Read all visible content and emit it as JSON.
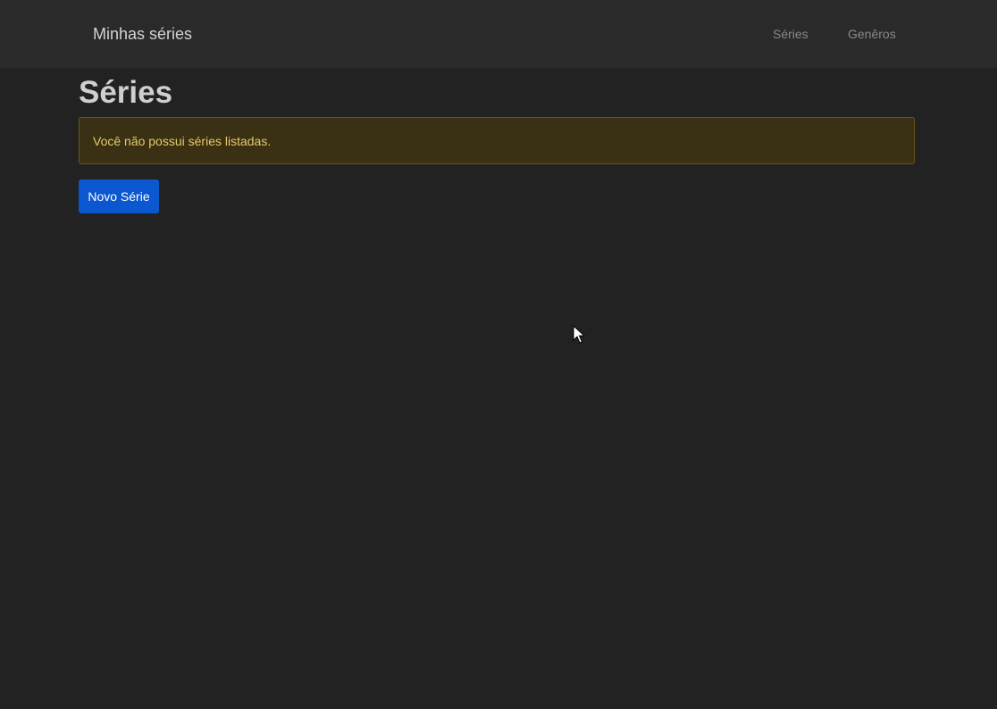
{
  "navbar": {
    "brand": "Minhas séries",
    "links": [
      {
        "label": "Séries"
      },
      {
        "label": "Genêros"
      }
    ]
  },
  "main": {
    "title": "Séries",
    "alert": {
      "message": "Você não possui séries listadas.",
      "color": "#e6c96a",
      "background": "#3a3014"
    },
    "new_button": {
      "label": "Novo Série",
      "color": "#0b57d0"
    }
  },
  "cursor": {
    "icon": "mouse-pointer-icon"
  }
}
